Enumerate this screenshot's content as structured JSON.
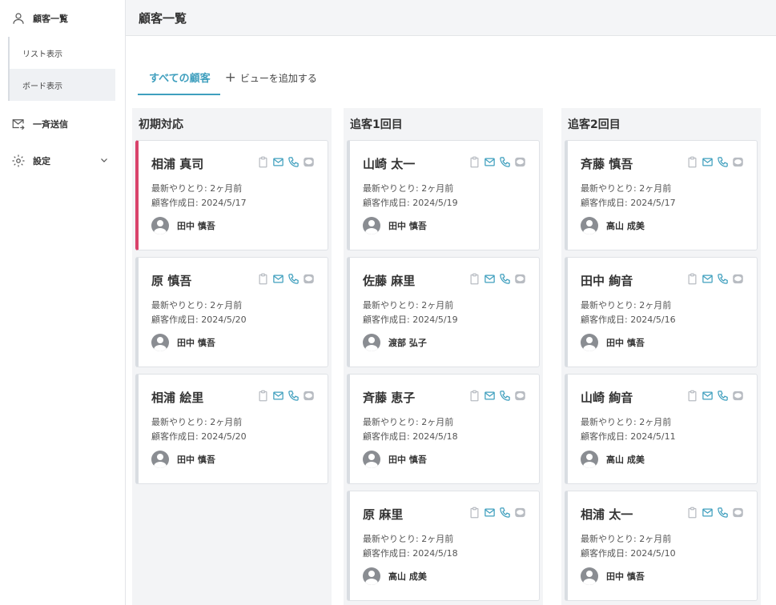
{
  "sidebar": {
    "items": [
      {
        "label": "顧客一覧",
        "icon": "user-icon"
      },
      {
        "label": "一斉送信",
        "icon": "mail-send-icon"
      },
      {
        "label": "設定",
        "icon": "gear-icon"
      }
    ],
    "sub_items": [
      {
        "label": "リスト表示",
        "active": false
      },
      {
        "label": "ボード表示",
        "active": true
      }
    ]
  },
  "header": {
    "title": "顧客一覧"
  },
  "tabs": {
    "all": "すべての顧客",
    "add": "ビューを追加する"
  },
  "colors": {
    "accent": "#3f9fbe",
    "highlight": "#d9436b",
    "line_icon": "#b8bcc2"
  },
  "columns": [
    {
      "title": "初期対応",
      "cards": [
        {
          "name": "相浦 真司",
          "last": "最新やりとり: 2ヶ月前",
          "created": "顧客作成日: 2024/5/17",
          "owner": "田中 慎吾",
          "highlight": true
        },
        {
          "name": "原 慎吾",
          "last": "最新やりとり: 2ヶ月前",
          "created": "顧客作成日: 2024/5/20",
          "owner": "田中 慎吾"
        },
        {
          "name": "相浦 絵里",
          "last": "最新やりとり: 2ヶ月前",
          "created": "顧客作成日: 2024/5/20",
          "owner": "田中 慎吾"
        }
      ]
    },
    {
      "title": "追客1回目",
      "cards": [
        {
          "name": "山崎 太一",
          "last": "最新やりとり: 2ヶ月前",
          "created": "顧客作成日: 2024/5/19",
          "owner": "田中 慎吾"
        },
        {
          "name": "佐藤 麻里",
          "last": "最新やりとり: 2ヶ月前",
          "created": "顧客作成日: 2024/5/19",
          "owner": "渡部 弘子"
        },
        {
          "name": "斉藤 恵子",
          "last": "最新やりとり: 2ヶ月前",
          "created": "顧客作成日: 2024/5/18",
          "owner": "田中 慎吾"
        },
        {
          "name": "原 麻里",
          "last": "最新やりとり: 2ヶ月前",
          "created": "顧客作成日: 2024/5/18",
          "owner": "高山 成美"
        }
      ]
    },
    {
      "title": "追客2回目",
      "cards": [
        {
          "name": "斉藤 慎吾",
          "last": "最新やりとり: 2ヶ月前",
          "created": "顧客作成日: 2024/5/17",
          "owner": "高山 成美"
        },
        {
          "name": "田中 絢音",
          "last": "最新やりとり: 2ヶ月前",
          "created": "顧客作成日: 2024/5/16",
          "owner": "田中 慎吾"
        },
        {
          "name": "山崎 絢音",
          "last": "最新やりとり: 2ヶ月前",
          "created": "顧客作成日: 2024/5/11",
          "owner": "高山 成美"
        },
        {
          "name": "相浦 太一",
          "last": "最新やりとり: 2ヶ月前",
          "created": "顧客作成日: 2024/5/10",
          "owner": "田中 慎吾"
        }
      ]
    }
  ]
}
